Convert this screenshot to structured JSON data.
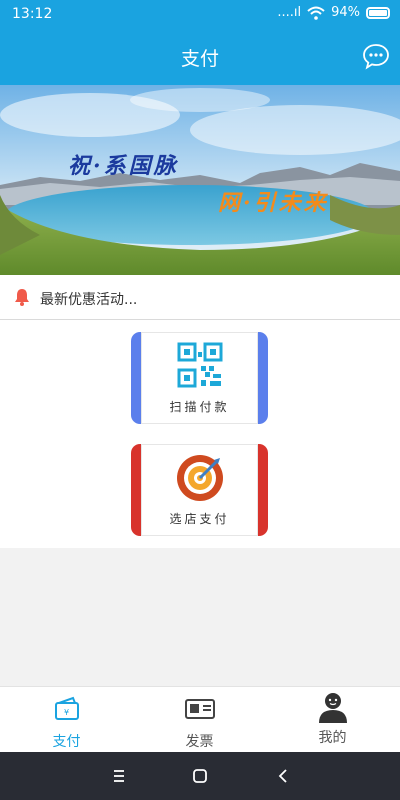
{
  "status_bar": {
    "time": "13:12",
    "signal": "....ıl",
    "battery": "94%"
  },
  "header": {
    "title": "支付",
    "chat_icon": "chat-bubble-icon"
  },
  "banner": {
    "caption_left": "祝·系国脉",
    "caption_right": "网·引未来"
  },
  "notice": {
    "bell_icon": "bell-icon",
    "text": "最新优惠活动..."
  },
  "cards": {
    "scan": {
      "label": "扫描付款",
      "icon": "qr-code-icon",
      "accent": "#5b7fec"
    },
    "store": {
      "label": "选店支付",
      "icon": "target-icon",
      "accent": "#d8332c"
    }
  },
  "tabs": [
    {
      "label": "支付",
      "icon": "wallet-icon",
      "active": true
    },
    {
      "label": "发票",
      "icon": "invoice-icon",
      "active": false
    },
    {
      "label": "我的",
      "icon": "user-icon",
      "active": false
    }
  ],
  "colors": {
    "primary": "#1aa3e0",
    "nav_bg": "#292c34"
  }
}
